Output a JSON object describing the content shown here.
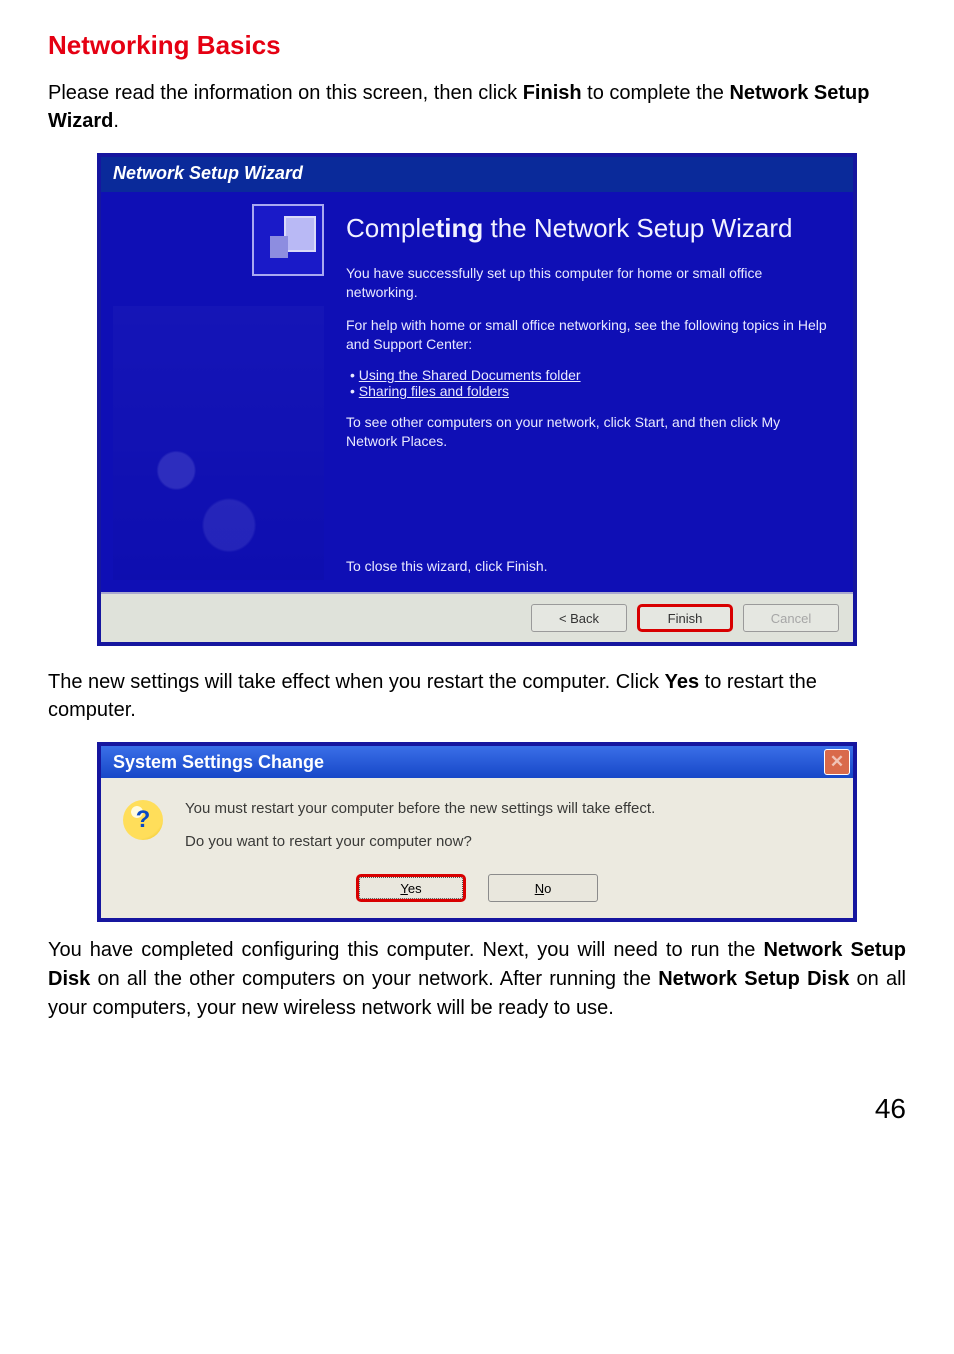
{
  "heading": "Networking Basics",
  "intro1": "Please read the information on this screen, then click ",
  "intro1_bold": "Finish",
  "intro1_end": " to complete the ",
  "intro1_bold2": "Network Setup Wizard",
  "intro1_period": ".",
  "wizard": {
    "title": "Network Setup Wizard",
    "main_title_a": "Comple",
    "main_title_b": "ting",
    "main_title_c": " the Network Setup Wizard",
    "para1": "You have successfully set up this computer for home or small office networking.",
    "para2": "For help with home or small office networking, see the following topics in Help and Support Center:",
    "link1": "Using the Shared Documents folder",
    "link2": "Sharing files and folders",
    "para3": "To see other computers on your network, click Start, and then click My Network Places.",
    "close_text": "To close this wizard, click Finish.",
    "buttons": {
      "back": "< Back",
      "finish": "Finish",
      "cancel": "Cancel"
    }
  },
  "mid_text1": "The new settings will take effect when you restart the computer. Click ",
  "mid_bold": "Yes",
  "mid_text2": " to restart the computer.",
  "dialog": {
    "title": "System Settings Change",
    "close_glyph": "✕",
    "icon_glyph": "?",
    "line1": "You must restart your computer before the new settings will take effect.",
    "line2": "Do you want to restart your computer now?",
    "yes_u": "Y",
    "yes_rest": "es",
    "no_u": "N",
    "no_rest": "o"
  },
  "body_end_a": "You have completed configuring this computer. Next, you will need to run the ",
  "body_end_b1": "Network Setup Disk",
  "body_end_c": " on all the other computers on your network. After running the ",
  "body_end_b2": "Network Setup Disk",
  "body_end_d": " on all your computers, your new wireless network will be ready to use.",
  "page_number": "46"
}
